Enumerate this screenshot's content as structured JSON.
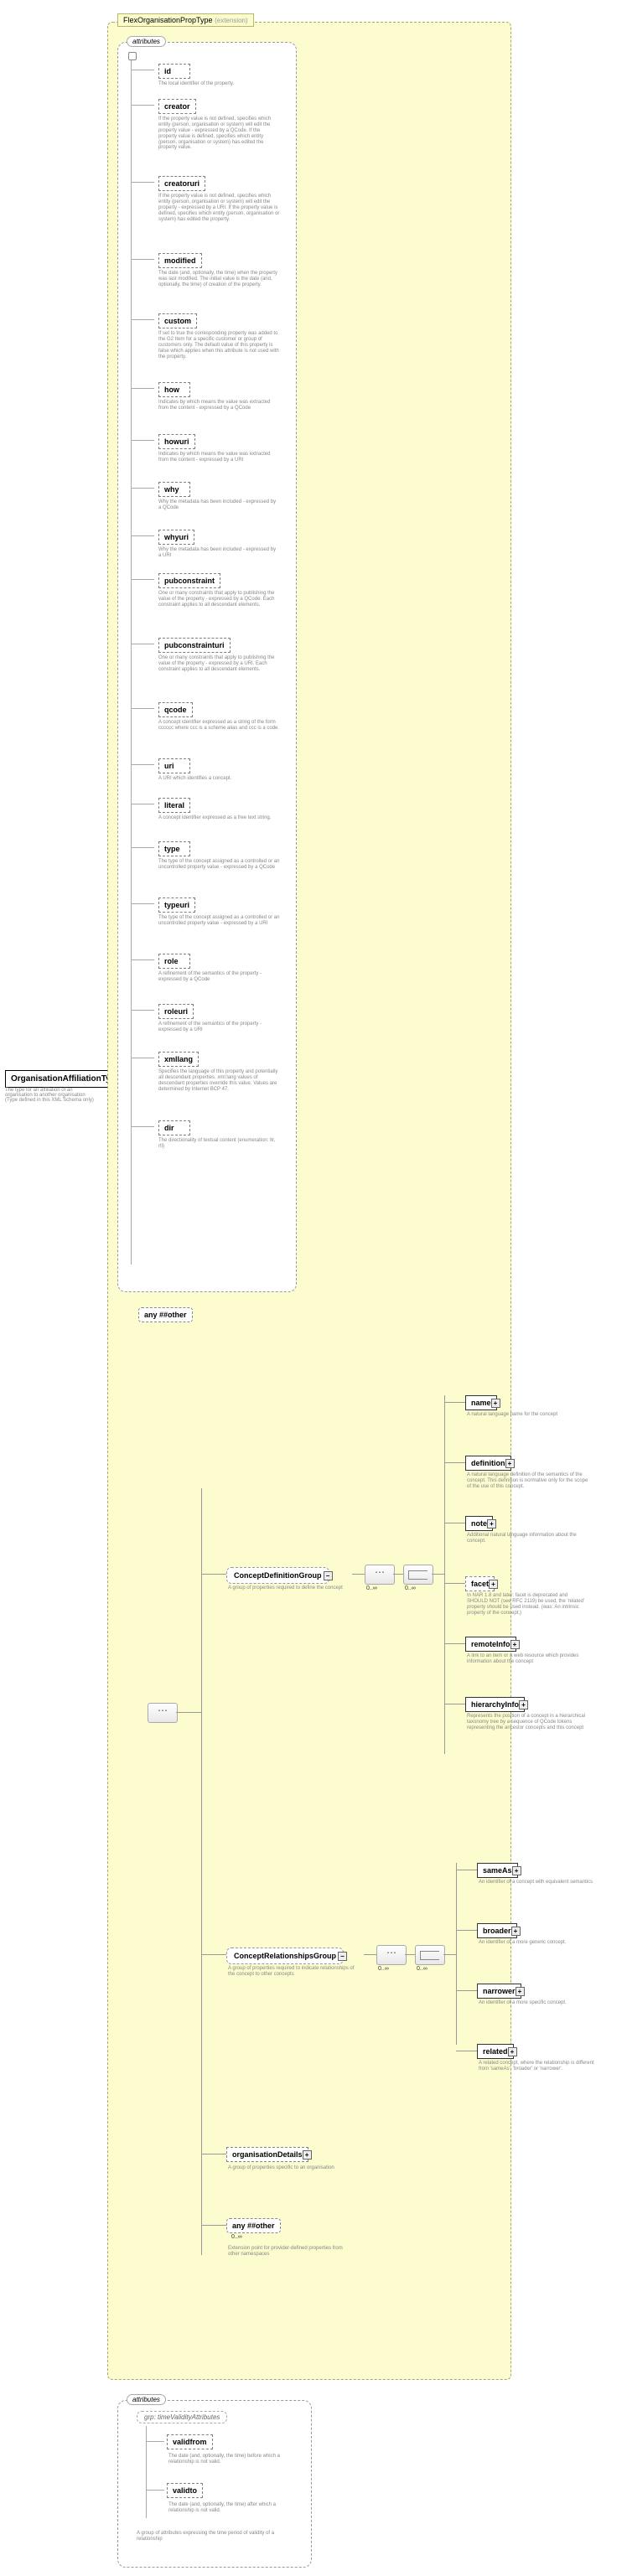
{
  "root": {
    "name": "OrganisationAffiliationType",
    "desc": "The type for an affiliation of an organisation to another organisation (Type defined in this XML Schema only)"
  },
  "extension": {
    "name": "FlexOrganisationPropType",
    "note": "(extension)"
  },
  "attributes_label": "attributes",
  "attributes": [
    {
      "name": "id",
      "desc": "The local identifier of the property.",
      "h": 20
    },
    {
      "name": "creator",
      "desc": "If the property value is not defined, specifies which entity (person, organisation or system) will edit the property value - expressed by a QCode. If the property value is defined, specifies which entity (person, organisation or system) has edited the property value.",
      "h": 70
    },
    {
      "name": "creatoruri",
      "desc": "If the property value is not defined, specifies which entity (person, organisation or system) will edit the property - expressed by a URI. If the property value is defined, specifies which entity (person, organisation or system) has edited the property.",
      "h": 70
    },
    {
      "name": "modified",
      "desc": "The date (and, optionally, the time) when the property was last modified. The initial value is the date (and, optionally, the time) of creation of the property.",
      "h": 50
    },
    {
      "name": "custom",
      "desc": "If set to true the corresponding property was added to the G2 Item for a specific customer or group of customers only. The default value of this property is false which applies when this attribute is not used with the property.",
      "h": 60
    },
    {
      "name": "how",
      "desc": "Indicates by which means the value was extracted from the content - expressed by a QCode",
      "h": 40
    },
    {
      "name": "howuri",
      "desc": "Indicates by which means the value was extracted from the content - expressed by a URI",
      "h": 35
    },
    {
      "name": "why",
      "desc": "Why the metadata has been included - expressed by a QCode",
      "h": 35
    },
    {
      "name": "whyuri",
      "desc": "Why the metadata has been included - expressed by a URI",
      "h": 30
    },
    {
      "name": "pubconstraint",
      "desc": "One or many constraints that apply to publishing the value of the property - expressed by a QCode. Each constraint applies to all descendant elements.",
      "h": 55
    },
    {
      "name": "pubconstrainturi",
      "desc": "One or many constraints that apply to publishing the value of the property - expressed by a URI. Each constraint applies to all descendant elements.",
      "h": 55
    },
    {
      "name": "qcode",
      "desc": "A concept identifier expressed as a string of the form cccccc where ccc is a scheme alias and ccc is a code.",
      "h": 45
    },
    {
      "name": "uri",
      "desc": "A URI which identifies a concept.",
      "h": 25
    },
    {
      "name": "literal",
      "desc": "A concept identifier expressed as a free text string.",
      "h": 30
    },
    {
      "name": "type",
      "desc": "The type of the concept assigned as a controlled or an uncontrolled property value - expressed by a QCode",
      "h": 45
    },
    {
      "name": "typeuri",
      "desc": "The type of the concept assigned as a controlled or an uncontrolled property value - expressed by a URI",
      "h": 45
    },
    {
      "name": "role",
      "desc": "A refinement of the semantics of the property - expressed by a QCode",
      "h": 38
    },
    {
      "name": "roleuri",
      "desc": "A refinement of the semantics of the property - expressed by a URI",
      "h": 35
    },
    {
      "name": "xmllang",
      "desc": "Specifies the language of this property and potentially all descendant properties. xml:lang values of descendant properties override this value. Values are determined by Internet BCP 47.",
      "h": 60
    },
    {
      "name": "dir",
      "desc": "The directionality of textual content (enumeration: ltr, rtl)",
      "h": 30
    }
  ],
  "anyOther": "any ##other",
  "conceptDefinitionGroup": {
    "name": "ConceptDefinitionGroup",
    "desc": "A group of properties required to define the concept"
  },
  "definition_children": [
    {
      "name": "name",
      "desc": "A natural language name for the concept",
      "dashed": false
    },
    {
      "name": "definition",
      "desc": "A natural language definition of the semantics of the concept. This definition is normative only for the scope of the use of this concept.",
      "dashed": false
    },
    {
      "name": "note",
      "desc": "Additional natural language information about the concept.",
      "dashed": false
    },
    {
      "name": "facet",
      "desc": "In NAR 1.8 and later: facet is deprecated and SHOULD NOT (see RFC 2119) be used, the 'related' property should be used instead. (was: An intrinsic property of the concept.)",
      "dashed": true
    },
    {
      "name": "remoteInfo",
      "desc": "A link to an item or a web resource which provides information about the concept",
      "dashed": false
    },
    {
      "name": "hierarchyInfo",
      "desc": "Represents the position of a concept in a hierarchical taxonomy tree by a sequence of QCode tokens representing the ancestor concepts and this concept",
      "dashed": false
    }
  ],
  "conceptRelationshipsGroup": {
    "name": "ConceptRelationshipsGroup",
    "desc": "A group of properties required to indicate relationships of the concept to other concepts"
  },
  "relationship_children": [
    {
      "name": "sameAs",
      "desc": "An identifier of a concept with equivalent semantics"
    },
    {
      "name": "broader",
      "desc": "An identifier of a more generic concept."
    },
    {
      "name": "narrower",
      "desc": "An identifier of a more specific concept."
    },
    {
      "name": "related",
      "desc": "A related concept, where the relationship is different from 'sameAs', 'broader' or 'narrower'."
    }
  ],
  "organisationDetails": {
    "name": "organisationDetails",
    "desc": "A group of properties specific to an organisation"
  },
  "otherAny": {
    "name": "any ##other",
    "desc": "Extension point for provider-defined properties from other namespaces"
  },
  "timeValidity": {
    "grp": "grp: timeValidityAttributes",
    "attrs": [
      {
        "name": "validfrom",
        "desc": "The date (and, optionally, the time) before which a relationship is not valid."
      },
      {
        "name": "validto",
        "desc": "The date (and, optionally, the time) after which a relationship is not valid."
      }
    ],
    "desc": "A group of attributes expressing the time period of validity of a relationship"
  },
  "cardinality_inf": "0..∞"
}
